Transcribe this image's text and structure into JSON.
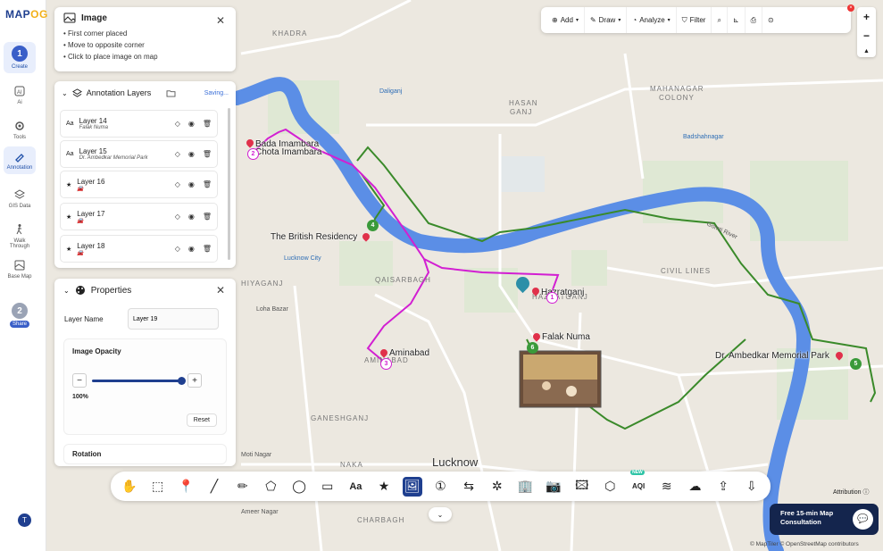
{
  "app": {
    "logo_main": "MAP",
    "logo_accent": "OG"
  },
  "rail": {
    "items": [
      {
        "label": "Create",
        "step": "1"
      },
      {
        "label": "Ai"
      },
      {
        "label": "Tools"
      },
      {
        "label": "Annotation"
      },
      {
        "label": "GIS Data"
      },
      {
        "label": "Walk Through"
      },
      {
        "label": "Base Map"
      },
      {
        "label": "Share",
        "step": "2"
      }
    ],
    "avatar": "T"
  },
  "image_panel": {
    "title": "Image",
    "steps": [
      "• First corner placed",
      "• Move to opposite corner",
      "• Click to place image on map"
    ]
  },
  "layers_panel": {
    "title": "Annotation Layers",
    "saving": "Saving...",
    "layers": [
      {
        "name": "Layer 14",
        "sub": "Falak Numa"
      },
      {
        "name": "Layer 15",
        "sub": "Dr. Ambedkar Memorial Park"
      },
      {
        "name": "Layer 16",
        "sub": ""
      },
      {
        "name": "Layer 17",
        "sub": ""
      },
      {
        "name": "Layer 18",
        "sub": ""
      }
    ]
  },
  "props_panel": {
    "title": "Properties",
    "layer_name_label": "Layer Name",
    "layer_name_value": "Layer 19",
    "opacity_title": "Image Opacity",
    "opacity_value": 1.0,
    "opacity_label": "100%",
    "reset": "Reset",
    "rotation": "Rotation"
  },
  "topbar": {
    "add": "Add",
    "draw": "Draw",
    "analyze": "Analyze",
    "filter": "Filter"
  },
  "zoom": {
    "in": "+",
    "out": "−",
    "north": "▲"
  },
  "map_labels": {
    "khadra": "KHADRA",
    "daliganj": "Daliganj",
    "hasan_ganj": "HASAN",
    "hasan_ganj2": "GANJ",
    "mahanagar": "MAHANAGAR",
    "mahanagar2": "COLONY",
    "badshahnagar": "Badshahnagar",
    "civil_lines": "CIVIL LINES",
    "qaisarbagh": "QAISARBAGH",
    "hiyaganj": "HIYAGANJ",
    "loha_bazar": "Loha Bazar",
    "lucknow_city": "Lucknow City",
    "ganeshganj": "GANESHGANJ",
    "moti_nagar": "Moti Nagar",
    "naka": "NAKA",
    "ameer_nagar": "Ameer Nagar",
    "charbagh": "CHARBAGH",
    "lucknow": "Lucknow",
    "aminabad_area": "AMINABAD",
    "hazratganj_area": "HAZRATGANJ",
    "gomti": "Gomti River"
  },
  "pois": {
    "bada": "Bada Imambara",
    "chota": "Chota Imambara",
    "british": "The British Residency",
    "hazratganj": "Hazratganj",
    "falak": "Falak Numa",
    "aminabad": "Aminabad",
    "ambedkar": "Dr. Ambedkar Memorial Park"
  },
  "markers": {
    "m1": "1",
    "m2": "2",
    "m3": "3",
    "m4": "4",
    "m5": "5",
    "m6": "6"
  },
  "consult": {
    "line1": "Free 15-min Map",
    "line2": "Consultation"
  },
  "attribution_btn": "Attribution",
  "attribution": "© MapTiler © OpenStreetMap contributors",
  "colors": {
    "route_pink": "#d21fd2",
    "route_green": "#3a8a2a",
    "river": "#5b8ee6",
    "accent": "#1f3f8f"
  }
}
